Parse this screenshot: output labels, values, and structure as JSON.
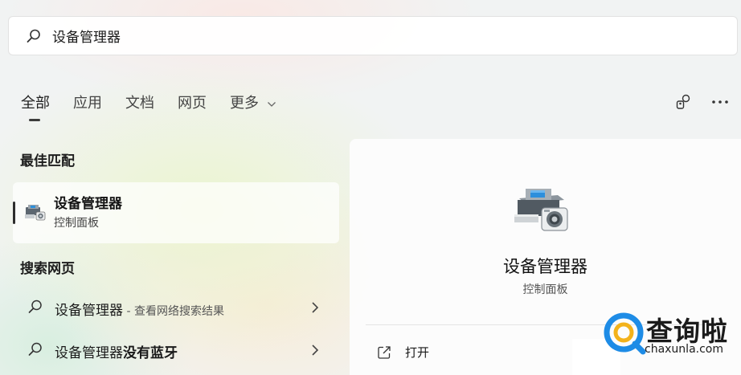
{
  "search": {
    "query": "设备管理器"
  },
  "tabs": [
    {
      "label": "全部"
    },
    {
      "label": "应用"
    },
    {
      "label": "文档"
    },
    {
      "label": "网页"
    },
    {
      "label": "更多"
    }
  ],
  "toolbar": {
    "icons": [
      "accounts-icon",
      "more-options-icon"
    ]
  },
  "best_match": {
    "section_title": "最佳匹配",
    "title": "设备管理器",
    "subtitle": "控制面板"
  },
  "web": {
    "section_title": "搜索网页",
    "items": [
      {
        "text": "设备管理器",
        "hint": " - 查看网络搜索结果"
      },
      {
        "text": "设备管理器",
        "bold": "没有蓝牙"
      }
    ]
  },
  "detail": {
    "title": "设备管理器",
    "subtitle": "控制面板",
    "actions": [
      {
        "label": "打开"
      }
    ]
  },
  "watermark": {
    "title": "查询啦",
    "url": "chaxunla.com"
  },
  "colors": {
    "accent_blue": "#1e8ce6",
    "indicator": "#2d2d2d",
    "panel_bg": "#fcfcfc"
  }
}
